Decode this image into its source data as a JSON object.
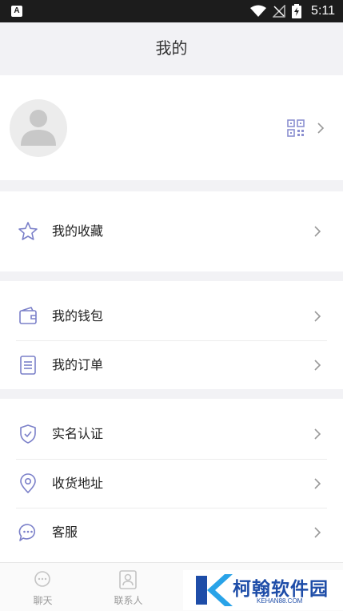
{
  "status_bar": {
    "app_badge": "A",
    "time": "5:11",
    "icons": [
      "wifi-icon",
      "signal-icon",
      "battery-charging-icon"
    ]
  },
  "header": {
    "title": "我的"
  },
  "profile": {
    "avatar_icon": "default-avatar-icon",
    "qr_icon": "qr-code-icon"
  },
  "menu": {
    "favorites": "我的收藏",
    "wallet": "我的钱包",
    "orders": "我的订单",
    "verification": "实名认证",
    "address": "收货地址",
    "service": "客服"
  },
  "tabs": [
    {
      "label": "聊天",
      "icon": "chat-icon"
    },
    {
      "label": "联系人",
      "icon": "contacts-icon"
    }
  ],
  "watermark": {
    "text": "柯翰软件园",
    "sub": "KEHAN88.COM"
  },
  "colors": {
    "accent": "#7b80c9",
    "background": "#f2f2f5",
    "card": "#ffffff"
  }
}
